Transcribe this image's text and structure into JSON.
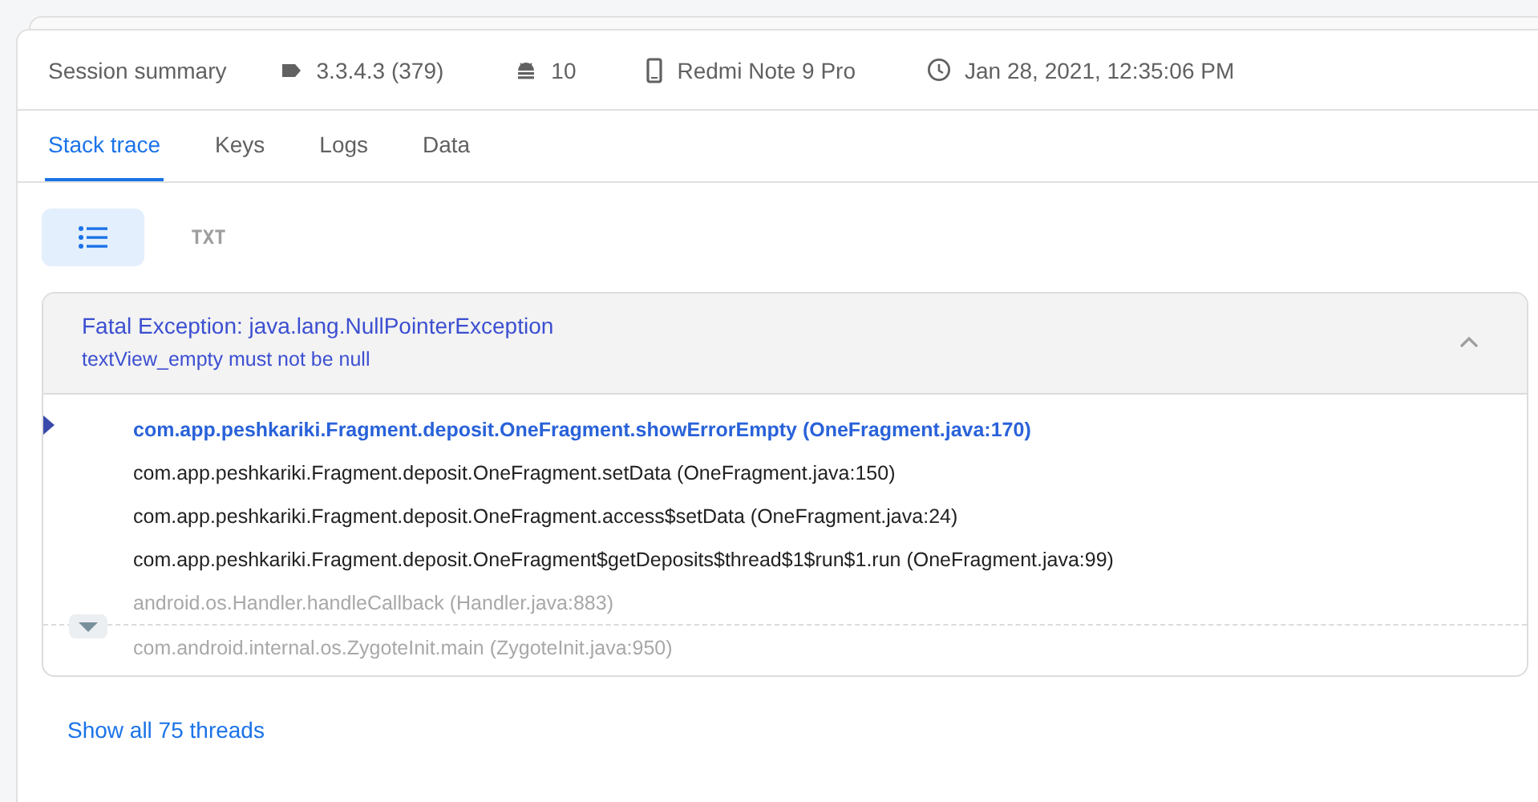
{
  "summary": {
    "title": "Session summary",
    "items": [
      {
        "kind": "version",
        "text": "3.3.4.3 (379)"
      },
      {
        "kind": "os",
        "text": "10"
      },
      {
        "kind": "device",
        "text": "Redmi Note 9 Pro"
      },
      {
        "kind": "time",
        "text": "Jan 28, 2021, 12:35:06 PM"
      }
    ]
  },
  "tabs": [
    {
      "label": "Stack trace",
      "selected": true
    },
    {
      "label": "Keys",
      "selected": false
    },
    {
      "label": "Logs",
      "selected": false
    },
    {
      "label": "Data",
      "selected": false
    }
  ],
  "view_toggle": [
    {
      "kind": "list",
      "selected": true
    },
    {
      "kind": "text",
      "label": "TXT",
      "selected": false
    }
  ],
  "exception": {
    "title": "Fatal Exception: java.lang.NullPointerException",
    "message": "textView_empty must not be null",
    "expanded": true,
    "frames": [
      {
        "text": "com.app.peshkariki.Fragment.deposit.OneFragment.showErrorEmpty (OneFragment.java:170)",
        "kind": "app",
        "selected": true
      },
      {
        "text": "com.app.peshkariki.Fragment.deposit.OneFragment.setData (OneFragment.java:150)",
        "kind": "app",
        "selected": false
      },
      {
        "text": "com.app.peshkariki.Fragment.deposit.OneFragment.access$setData (OneFragment.java:24)",
        "kind": "app",
        "selected": false
      },
      {
        "text": "com.app.peshkariki.Fragment.deposit.OneFragment$getDeposits$thread$1$run$1.run (OneFragment.java:99)",
        "kind": "app",
        "selected": false
      },
      {
        "text": "android.os.Handler.handleCallback (Handler.java:883)",
        "kind": "system",
        "selected": false
      },
      {
        "text": "com.android.internal.os.ZygoteInit.main (ZygoteInit.java:950)",
        "kind": "system",
        "selected": false,
        "collapsed_before": true
      }
    ]
  },
  "show_all_link": "Show all 75 threads"
}
